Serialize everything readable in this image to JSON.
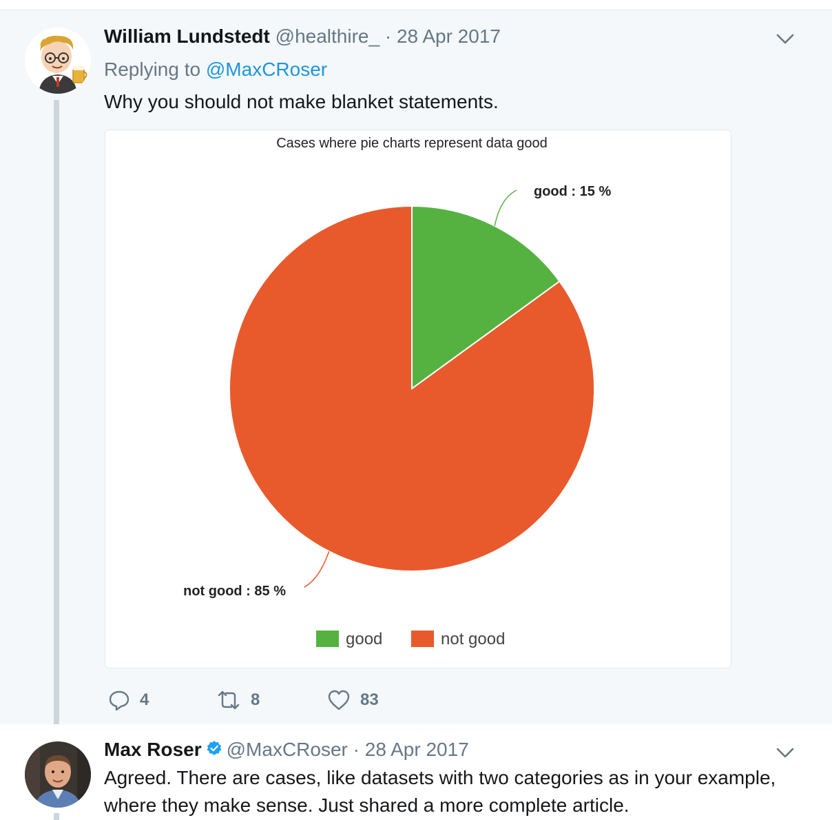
{
  "tweets": [
    {
      "author_name": "William Lundstedt",
      "handle": "@healthire_",
      "separator": "·",
      "date": "28 Apr 2017",
      "replying_prefix": "Replying to",
      "replying_to": "@MaxCRoser",
      "text": "Why you should not make blanket statements.",
      "avatar_icon": "cartoon-avatar-icon",
      "actions": {
        "reply_count": "4",
        "retweet_count": "8",
        "like_count": "83"
      }
    },
    {
      "author_name": "Max Roser",
      "verified": true,
      "handle": "@MaxCRoser",
      "separator": "·",
      "date": "28 Apr 2017",
      "text_line1": "Agreed. There are cases, like datasets with two categories as in your example,",
      "text_line2": "where they make sense. Just shared a more complete article.",
      "avatar_icon": "photo-avatar-icon"
    }
  ],
  "colors": {
    "good": "#55b240",
    "not_good": "#e85a2c",
    "link": "#1b95e0",
    "muted": "#657786",
    "verified": "#1da1f2"
  },
  "chart_data": {
    "type": "pie",
    "title": "Cases where pie charts represent data good",
    "categories": [
      "good",
      "not good"
    ],
    "values": [
      15,
      85
    ],
    "unit": "%",
    "slice_labels": [
      "good : 15 %",
      "not good : 85 %"
    ],
    "colors": [
      "#55b240",
      "#e85a2c"
    ],
    "legend": [
      "good",
      "not good"
    ],
    "legend_position": "bottom"
  }
}
